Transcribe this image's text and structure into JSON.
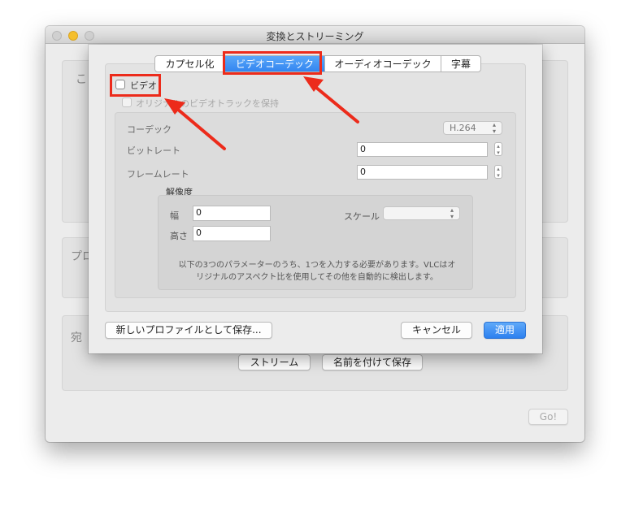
{
  "window": {
    "title": "変換とストリーミング",
    "traffic_lights": {
      "close": "#fc5b57",
      "minimize": "#f5bf2d",
      "zoom": "#d3d3d3"
    },
    "background_groups": {
      "source_label": "こ",
      "profile_label": "プロ",
      "destination_label": "宛"
    },
    "buttons": {
      "stream": "ストリーム",
      "save_as": "名前を付けて保存",
      "go": "Go!"
    }
  },
  "sheet": {
    "tabs": [
      {
        "label": "カプセル化",
        "active": false
      },
      {
        "label": "ビデオコーデック",
        "active": true
      },
      {
        "label": "オーディオコーデック",
        "active": false
      },
      {
        "label": "字幕",
        "active": false
      }
    ],
    "video_checkbox": {
      "label": "ビデオ",
      "checked": false
    },
    "keep_original": {
      "label": "オリジナルのビデオトラックを保持",
      "checked": false,
      "enabled": false
    },
    "codec": {
      "label": "コーデック",
      "value": "H.264"
    },
    "bitrate": {
      "label": "ビットレート",
      "value": "0"
    },
    "framerate": {
      "label": "フレームレート",
      "value": "0"
    },
    "resolution": {
      "title": "解像度",
      "width_label": "幅",
      "width_value": "0",
      "height_label": "高さ",
      "height_value": "0",
      "scale_label": "スケール",
      "scale_value": "",
      "note_line1": "以下の3つのパラメーターのうち、1つを入力する必要があります。VLCはオ",
      "note_line2": "リジナルのアスペクト比を使用してその他を自動的に検出します。"
    },
    "buttons": {
      "save_profile": "新しいプロファイルとして保存...",
      "cancel": "キャンセル",
      "apply": "適用"
    }
  },
  "annotations": {
    "highlight_color": "#ec2b1b"
  }
}
